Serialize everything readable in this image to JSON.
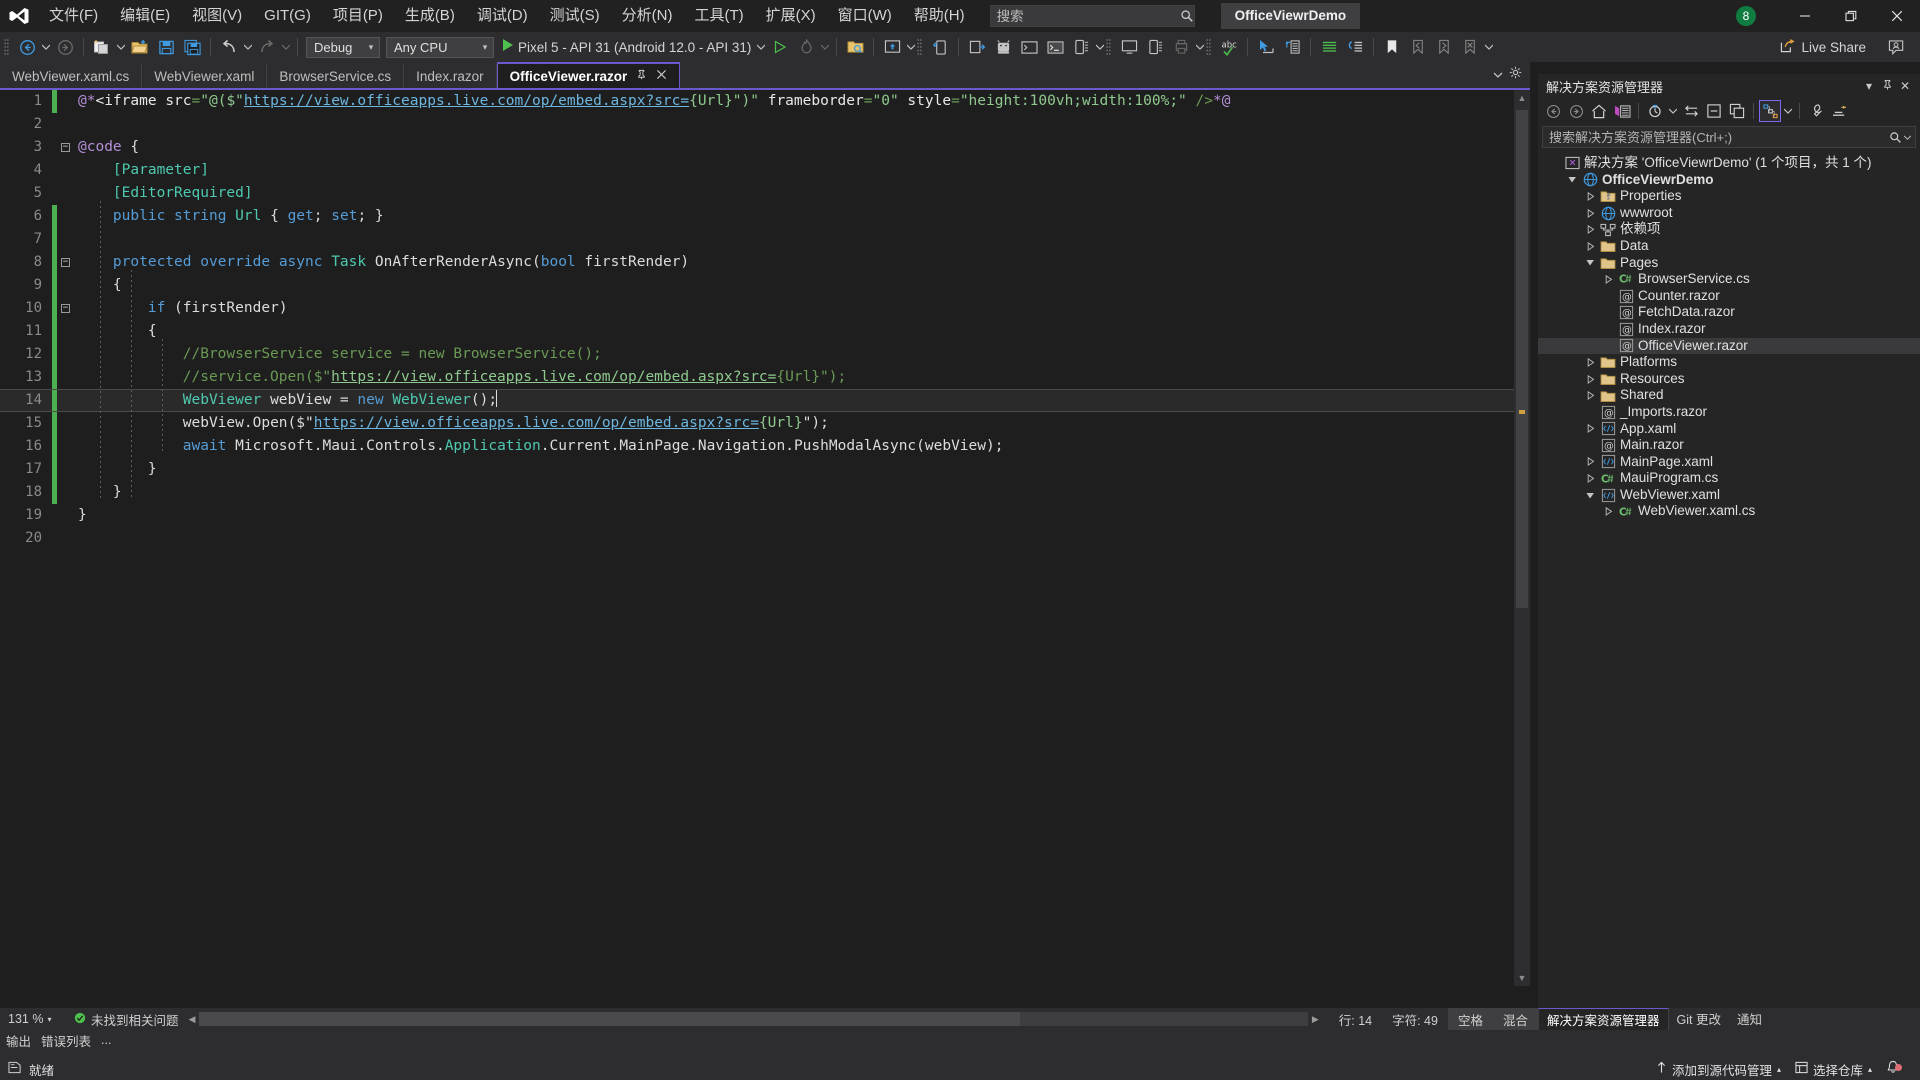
{
  "titlebar": {
    "logo_icon": "visual-studio-logo",
    "menus": [
      {
        "label": "文件(F)"
      },
      {
        "label": "编辑(E)"
      },
      {
        "label": "视图(V)"
      },
      {
        "label": "GIT(G)"
      },
      {
        "label": "项目(P)"
      },
      {
        "label": "生成(B)"
      },
      {
        "label": "调试(D)"
      },
      {
        "label": "测试(S)"
      },
      {
        "label": "分析(N)"
      },
      {
        "label": "工具(T)"
      },
      {
        "label": "扩展(X)"
      },
      {
        "label": "窗口(W)"
      },
      {
        "label": "帮助(H)"
      }
    ],
    "search": {
      "placeholder": "搜索",
      "value": "",
      "icon": "search-icon"
    },
    "solution_name": "OfficeViewrDemo",
    "account_badge": "8",
    "minimize": "—",
    "maximize": "❐",
    "close": "✕"
  },
  "toolbar": {
    "nav_back_icon": "navigate-back-icon",
    "nav_forward_icon": "navigate-forward-icon",
    "new_project_icon": "new-project-icon",
    "open_file_icon": "open-file-icon",
    "save_icon": "save-icon",
    "save_all_icon": "save-all-icon",
    "undo_icon": "undo-icon",
    "redo_icon": "redo-icon",
    "configuration": {
      "value": "Debug",
      "arrow": "▾"
    },
    "platform": {
      "value": "Any CPU",
      "arrow": "▾"
    },
    "run_target": {
      "label": "Pixel 5 - API 31 (Android 12.0 - API 31)",
      "icon": "play-icon",
      "arrow": "▾"
    },
    "run_without_debug_icon": "play-outline-icon",
    "hot_reload_icon": "hot-reload-icon",
    "live_share": {
      "label": "Live Share",
      "icon": "live-share-icon"
    },
    "live_share_session_icon": "live-share-session-icon"
  },
  "tabs": {
    "items": [
      {
        "label": "WebViewer.xaml.cs",
        "active": false
      },
      {
        "label": "WebViewer.xaml",
        "active": false
      },
      {
        "label": "BrowserService.cs",
        "active": false
      },
      {
        "label": "Index.razor",
        "active": false
      },
      {
        "label": "OfficeViewer.razor",
        "active": true,
        "pin_icon": "pin-icon",
        "close_icon": "close-icon"
      }
    ],
    "overflow_icon": "chevron-down-icon",
    "settings_icon": "gear-icon"
  },
  "editor": {
    "current_line": 14,
    "lines": [
      {
        "n": 1,
        "change": "green",
        "fold": "",
        "text": "@*<iframe src=\"@($\"https://view.officeapps.live.com/op/embed.aspx?src={Url}\")\" frameborder=\"0\" style=\"height:100vh;width:100%;\" />*@"
      },
      {
        "n": 2,
        "change": "",
        "fold": "",
        "text": ""
      },
      {
        "n": 3,
        "change": "",
        "fold": "open",
        "text": "@code {"
      },
      {
        "n": 4,
        "change": "",
        "fold": "",
        "text": "    [Parameter]"
      },
      {
        "n": 5,
        "change": "",
        "fold": "",
        "text": "    [EditorRequired]"
      },
      {
        "n": 6,
        "change": "green",
        "fold": "",
        "text": "    public string Url { get; set; }"
      },
      {
        "n": 7,
        "change": "green",
        "fold": "",
        "text": ""
      },
      {
        "n": 8,
        "change": "green",
        "fold": "open",
        "text": "    protected override async Task OnAfterRenderAsync(bool firstRender)"
      },
      {
        "n": 9,
        "change": "green",
        "fold": "",
        "text": "    {"
      },
      {
        "n": 10,
        "change": "green",
        "fold": "open",
        "text": "        if (firstRender)"
      },
      {
        "n": 11,
        "change": "green",
        "fold": "",
        "text": "        {"
      },
      {
        "n": 12,
        "change": "green",
        "fold": "",
        "text": "            //BrowserService service = new BrowserService();"
      },
      {
        "n": 13,
        "change": "green",
        "fold": "",
        "text": "            //service.Open($\"https://view.officeapps.live.com/op/embed.aspx?src={Url}\");"
      },
      {
        "n": 14,
        "change": "green",
        "fold": "",
        "text": "            WebViewer webView = new WebViewer();"
      },
      {
        "n": 15,
        "change": "green",
        "fold": "",
        "text": "            webView.Open($\"https://view.officeapps.live.com/op/embed.aspx?src={Url}\");"
      },
      {
        "n": 16,
        "change": "green",
        "fold": "",
        "text": "            await Microsoft.Maui.Controls.Application.Current.MainPage.Navigation.PushModalAsync(webView);"
      },
      {
        "n": 17,
        "change": "green",
        "fold": "",
        "text": "        }"
      },
      {
        "n": 18,
        "change": "green",
        "fold": "",
        "text": "    }"
      },
      {
        "n": 19,
        "change": "",
        "fold": "",
        "text": "}"
      },
      {
        "n": 20,
        "change": "",
        "fold": "",
        "text": ""
      }
    ]
  },
  "solution_explorer": {
    "title": "解决方案资源管理器",
    "header_buttons": [
      {
        "icon": "chevron-down-icon",
        "glyph": "▾"
      },
      {
        "icon": "pin-icon",
        "glyph": "⚲"
      },
      {
        "icon": "close-icon",
        "glyph": "✕"
      }
    ],
    "toolbar_icons": [
      "back-icon",
      "forward-icon",
      "home-icon",
      "pending-changes-icon",
      "refresh-icon",
      "sync-with-active-document-icon",
      "collapse-all-icon",
      "show-all-files-icon",
      "view-class-diagram-icon",
      "properties-icon",
      "preview-selected-items-icon"
    ],
    "search": {
      "placeholder": "搜索解决方案资源管理器(Ctrl+;)",
      "value": "",
      "icon": "search-icon"
    },
    "tree": [
      {
        "depth": 0,
        "arrow": "",
        "icon": "solution-icon",
        "label": "解决方案 'OfficeViewrDemo' (1 个项目，共 1 个)",
        "bold": false,
        "selected": false
      },
      {
        "depth": 1,
        "arrow": "▾",
        "icon": "web-project-icon",
        "label": "OfficeViewrDemo",
        "bold": true,
        "selected": false
      },
      {
        "depth": 2,
        "arrow": "▸",
        "icon": "properties-folder-icon",
        "label": "Properties",
        "bold": false,
        "selected": false
      },
      {
        "depth": 2,
        "arrow": "▸",
        "icon": "globe-icon",
        "label": "wwwroot",
        "bold": false,
        "selected": false
      },
      {
        "depth": 2,
        "arrow": "▸",
        "icon": "dependencies-icon",
        "label": "依赖项",
        "bold": false,
        "selected": false
      },
      {
        "depth": 2,
        "arrow": "▸",
        "icon": "folder-icon",
        "label": "Data",
        "bold": false,
        "selected": false
      },
      {
        "depth": 2,
        "arrow": "▾",
        "icon": "folder-icon",
        "label": "Pages",
        "bold": false,
        "selected": false
      },
      {
        "depth": 3,
        "arrow": "▸",
        "icon": "csharp-file-icon",
        "label": "BrowserService.cs",
        "bold": false,
        "selected": false
      },
      {
        "depth": 3,
        "arrow": "",
        "icon": "razor-file-icon",
        "label": "Counter.razor",
        "bold": false,
        "selected": false
      },
      {
        "depth": 3,
        "arrow": "",
        "icon": "razor-file-icon",
        "label": "FetchData.razor",
        "bold": false,
        "selected": false
      },
      {
        "depth": 3,
        "arrow": "",
        "icon": "razor-file-icon",
        "label": "Index.razor",
        "bold": false,
        "selected": false
      },
      {
        "depth": 3,
        "arrow": "",
        "icon": "razor-file-icon",
        "label": "OfficeViewer.razor",
        "bold": false,
        "selected": true
      },
      {
        "depth": 2,
        "arrow": "▸",
        "icon": "folder-icon",
        "label": "Platforms",
        "bold": false,
        "selected": false
      },
      {
        "depth": 2,
        "arrow": "▸",
        "icon": "folder-icon",
        "label": "Resources",
        "bold": false,
        "selected": false
      },
      {
        "depth": 2,
        "arrow": "▸",
        "icon": "folder-icon",
        "label": "Shared",
        "bold": false,
        "selected": false
      },
      {
        "depth": 2,
        "arrow": "",
        "icon": "razor-file-icon",
        "label": "_Imports.razor",
        "bold": false,
        "selected": false
      },
      {
        "depth": 2,
        "arrow": "▸",
        "icon": "xaml-file-icon",
        "label": "App.xaml",
        "bold": false,
        "selected": false
      },
      {
        "depth": 2,
        "arrow": "",
        "icon": "razor-file-icon",
        "label": "Main.razor",
        "bold": false,
        "selected": false
      },
      {
        "depth": 2,
        "arrow": "▸",
        "icon": "xaml-file-icon",
        "label": "MainPage.xaml",
        "bold": false,
        "selected": false
      },
      {
        "depth": 2,
        "arrow": "▸",
        "icon": "csharp-file-icon",
        "label": "MauiProgram.cs",
        "bold": false,
        "selected": false
      },
      {
        "depth": 2,
        "arrow": "▾",
        "icon": "xaml-file-icon",
        "label": "WebViewer.xaml",
        "bold": false,
        "selected": false
      },
      {
        "depth": 3,
        "arrow": "▸",
        "icon": "csharp-file-icon",
        "label": "WebViewer.xaml.cs",
        "bold": false,
        "selected": false
      }
    ]
  },
  "editor_status": {
    "zoom": "131 %",
    "zoom_arrow": "▾",
    "issues": "未找到相关问题",
    "issues_icon": "check-circle-icon",
    "line": "行: 14",
    "column": "字符: 49",
    "spaces": "空格",
    "encoding": "混合"
  },
  "se_tabs": [
    {
      "label": "解决方案资源管理器",
      "active": true
    },
    {
      "label": "Git 更改",
      "active": false
    },
    {
      "label": "通知",
      "active": false
    }
  ],
  "output_tabs": [
    {
      "label": "输出"
    },
    {
      "label": "错误列表"
    },
    {
      "label": "..."
    }
  ],
  "statusbar": {
    "ready_icon": "ready-icon",
    "ready": "就绪",
    "source_control": {
      "label": "添加到源代码管理",
      "icon": "up-arrow-icon",
      "arrow": "▴"
    },
    "repository": {
      "label": "选择仓库",
      "icon": "repo-icon",
      "arrow": "▴"
    },
    "notifications_icon": "bell-icon"
  },
  "colors": {
    "accent": "#6a5acd",
    "titlebar_bg": "#212121",
    "toolbar_bg": "#2d2d30",
    "editor_bg": "#1e1e1e",
    "panel_bg": "#252526",
    "badge_green": "#107c41",
    "change_green": "#4caf50"
  }
}
